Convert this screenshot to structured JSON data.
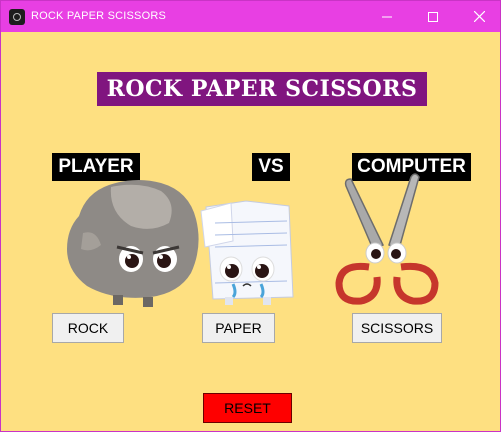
{
  "window": {
    "title": "ROCK PAPER SCISSORS",
    "bg": "#fee081",
    "titlebar_bg": "#e83fe3"
  },
  "titlebar_icons": [
    "minimize-icon",
    "maximize-icon",
    "close-icon"
  ],
  "heading": {
    "text": "ROCK PAPER SCISSORS",
    "bg": "#80157f"
  },
  "labels": {
    "player": "PLAYER",
    "vs": "VS",
    "computer": "COMPUTER"
  },
  "buttons": {
    "rock": "ROCK",
    "paper": "PAPER",
    "scissors": "SCISSORS",
    "reset": "RESET"
  },
  "reset_color": "#fe0000",
  "characters": [
    "rock-character",
    "paper-character",
    "scissors-character"
  ]
}
